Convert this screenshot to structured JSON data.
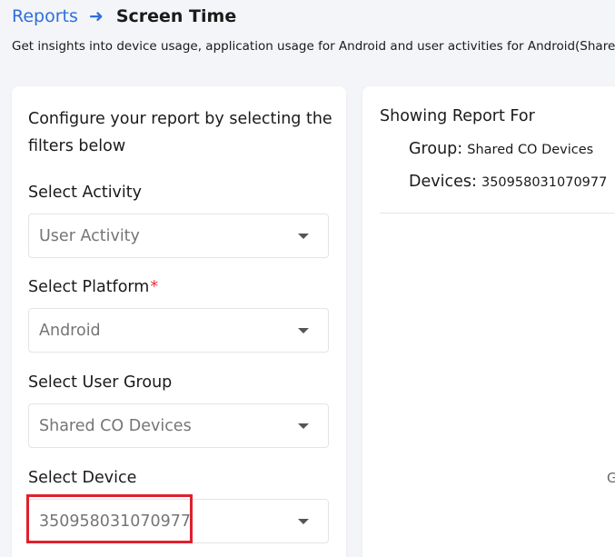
{
  "breadcrumb": {
    "parent": "Reports",
    "current": "Screen Time"
  },
  "subtitle": "Get insights into device usage, application usage for Android and user activities for Android(Share",
  "filters": {
    "heading": "Configure your report by selecting the filters below",
    "activity": {
      "label": "Select Activity",
      "value": "User Activity"
    },
    "platform": {
      "label": "Select Platform",
      "required_mark": "*",
      "value": "Android"
    },
    "user_group": {
      "label": "Select User Group",
      "value": "Shared CO Devices"
    },
    "device": {
      "label": "Select Device",
      "value": "350958031070977"
    }
  },
  "report": {
    "title": "Showing Report For",
    "group_label": "Group:",
    "group_value": "Shared CO Devices",
    "devices_label": "Devices:",
    "devices_value": "350958031070977",
    "edge_text": "G"
  },
  "colors": {
    "accent": "#2e6fdb",
    "required": "#e0343c",
    "highlight": "#e0202c"
  },
  "icons": {
    "breadcrumb_separator": "arrow-right-icon",
    "dropdown": "caret-down-icon"
  }
}
